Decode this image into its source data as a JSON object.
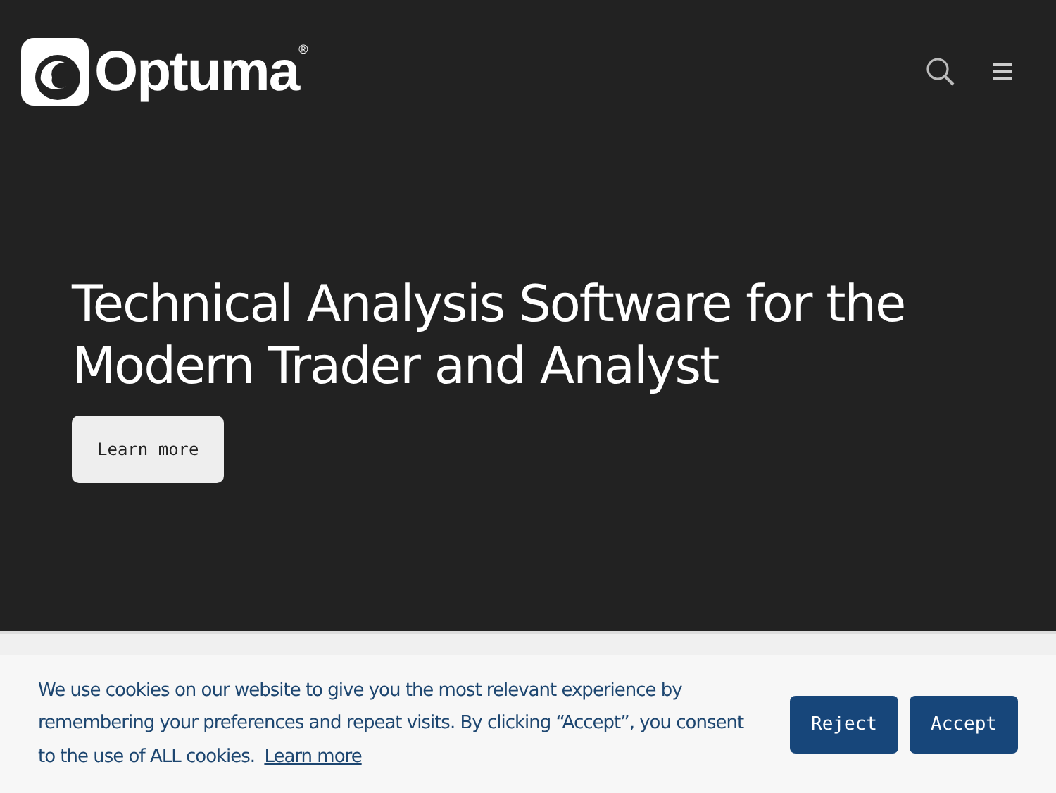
{
  "logo": {
    "name": "Optuma",
    "mark": "®"
  },
  "hero": {
    "title": "Technical Analysis Software for the Modern Trader and Analyst",
    "button": "Learn more"
  },
  "cookie_banner": {
    "text": "We use cookies on our website to give you the most relevant experience by remembering your preferences and repeat visits. By clicking “Accept”, you consent to the use of ALL cookies.",
    "link": "Learn more",
    "buttons": [
      "Reject",
      "Accept"
    ]
  }
}
